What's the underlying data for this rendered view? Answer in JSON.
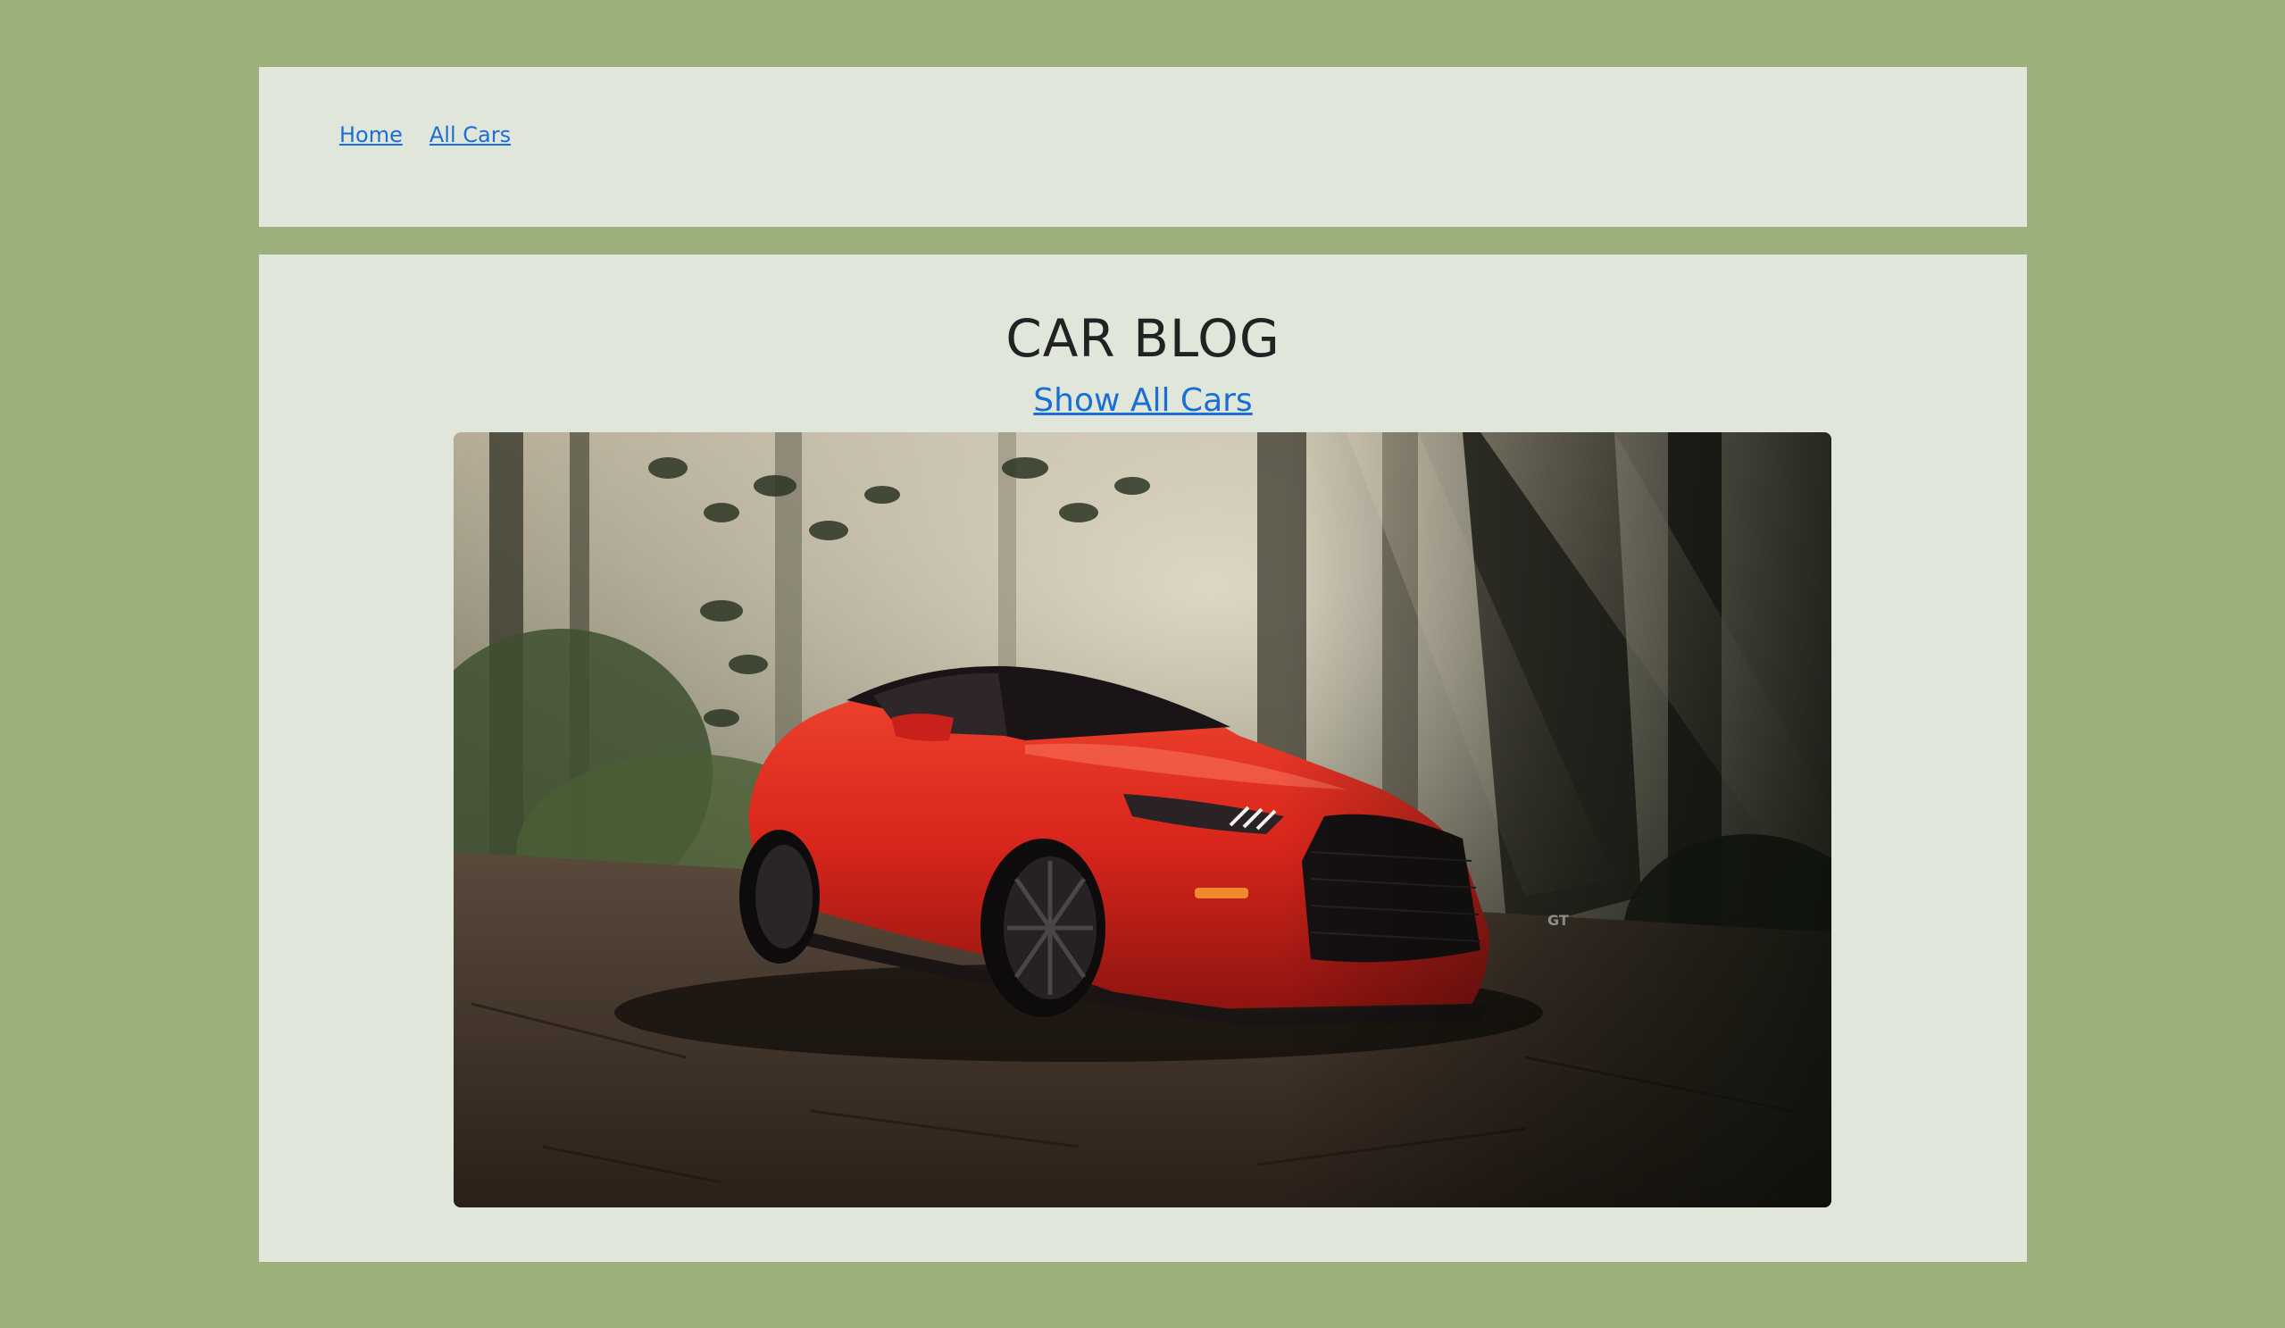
{
  "nav": {
    "home_label": "Home",
    "all_cars_label": "All Cars"
  },
  "main": {
    "title": "CAR BLOG",
    "show_all_label": "Show All Cars",
    "hero_image": {
      "badge_text": "GT"
    }
  },
  "colors": {
    "page_background": "#9bb07b",
    "panel_background": "#e0e7da",
    "link": "#1a6fd6",
    "title_text": "#222222",
    "car_red": "#d9261c"
  }
}
